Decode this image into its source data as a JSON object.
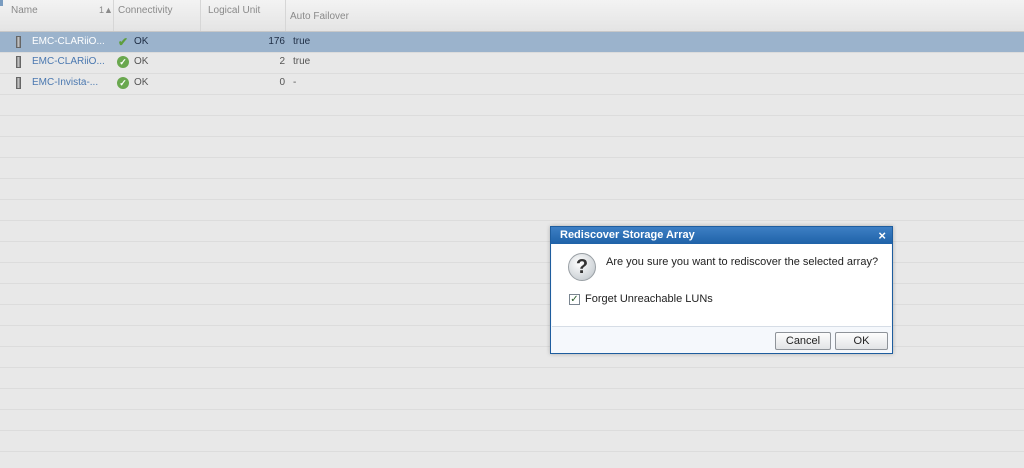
{
  "grid": {
    "columns": [
      {
        "label": "Name",
        "sort": "1▲"
      },
      {
        "label": "Connectivity"
      },
      {
        "label": "Logical Unit"
      },
      {
        "label": "Auto Failover"
      }
    ],
    "rows": [
      {
        "name": "EMC-CLARiiO...",
        "connectivity": "OK",
        "logical_unit": "176",
        "auto_failover": "true",
        "selected": true
      },
      {
        "name": "EMC-CLARiiO...",
        "connectivity": "OK",
        "logical_unit": "2",
        "auto_failover": "true",
        "selected": false
      },
      {
        "name": "EMC-Invista-...",
        "connectivity": "OK",
        "logical_unit": "0",
        "auto_failover": "-",
        "selected": false
      }
    ]
  },
  "dialog": {
    "title": "Rediscover Storage Array",
    "close_glyph": "×",
    "question_glyph": "?",
    "message": "Are you sure you want to rediscover the selected array?",
    "checkbox_label": "Forget Unreachable LUNs",
    "checkbox_checked": true,
    "check_glyph": "✓",
    "cancel_label": "Cancel",
    "ok_label": "OK"
  },
  "icons": {
    "device": "storage-device-icon",
    "status_ok": "check-circle-icon"
  },
  "colors": {
    "selection": "#9bb3cc",
    "dialog_title": "#1f62a8",
    "link_text": "#4a78b0",
    "ok_green": "#6aa84f"
  }
}
